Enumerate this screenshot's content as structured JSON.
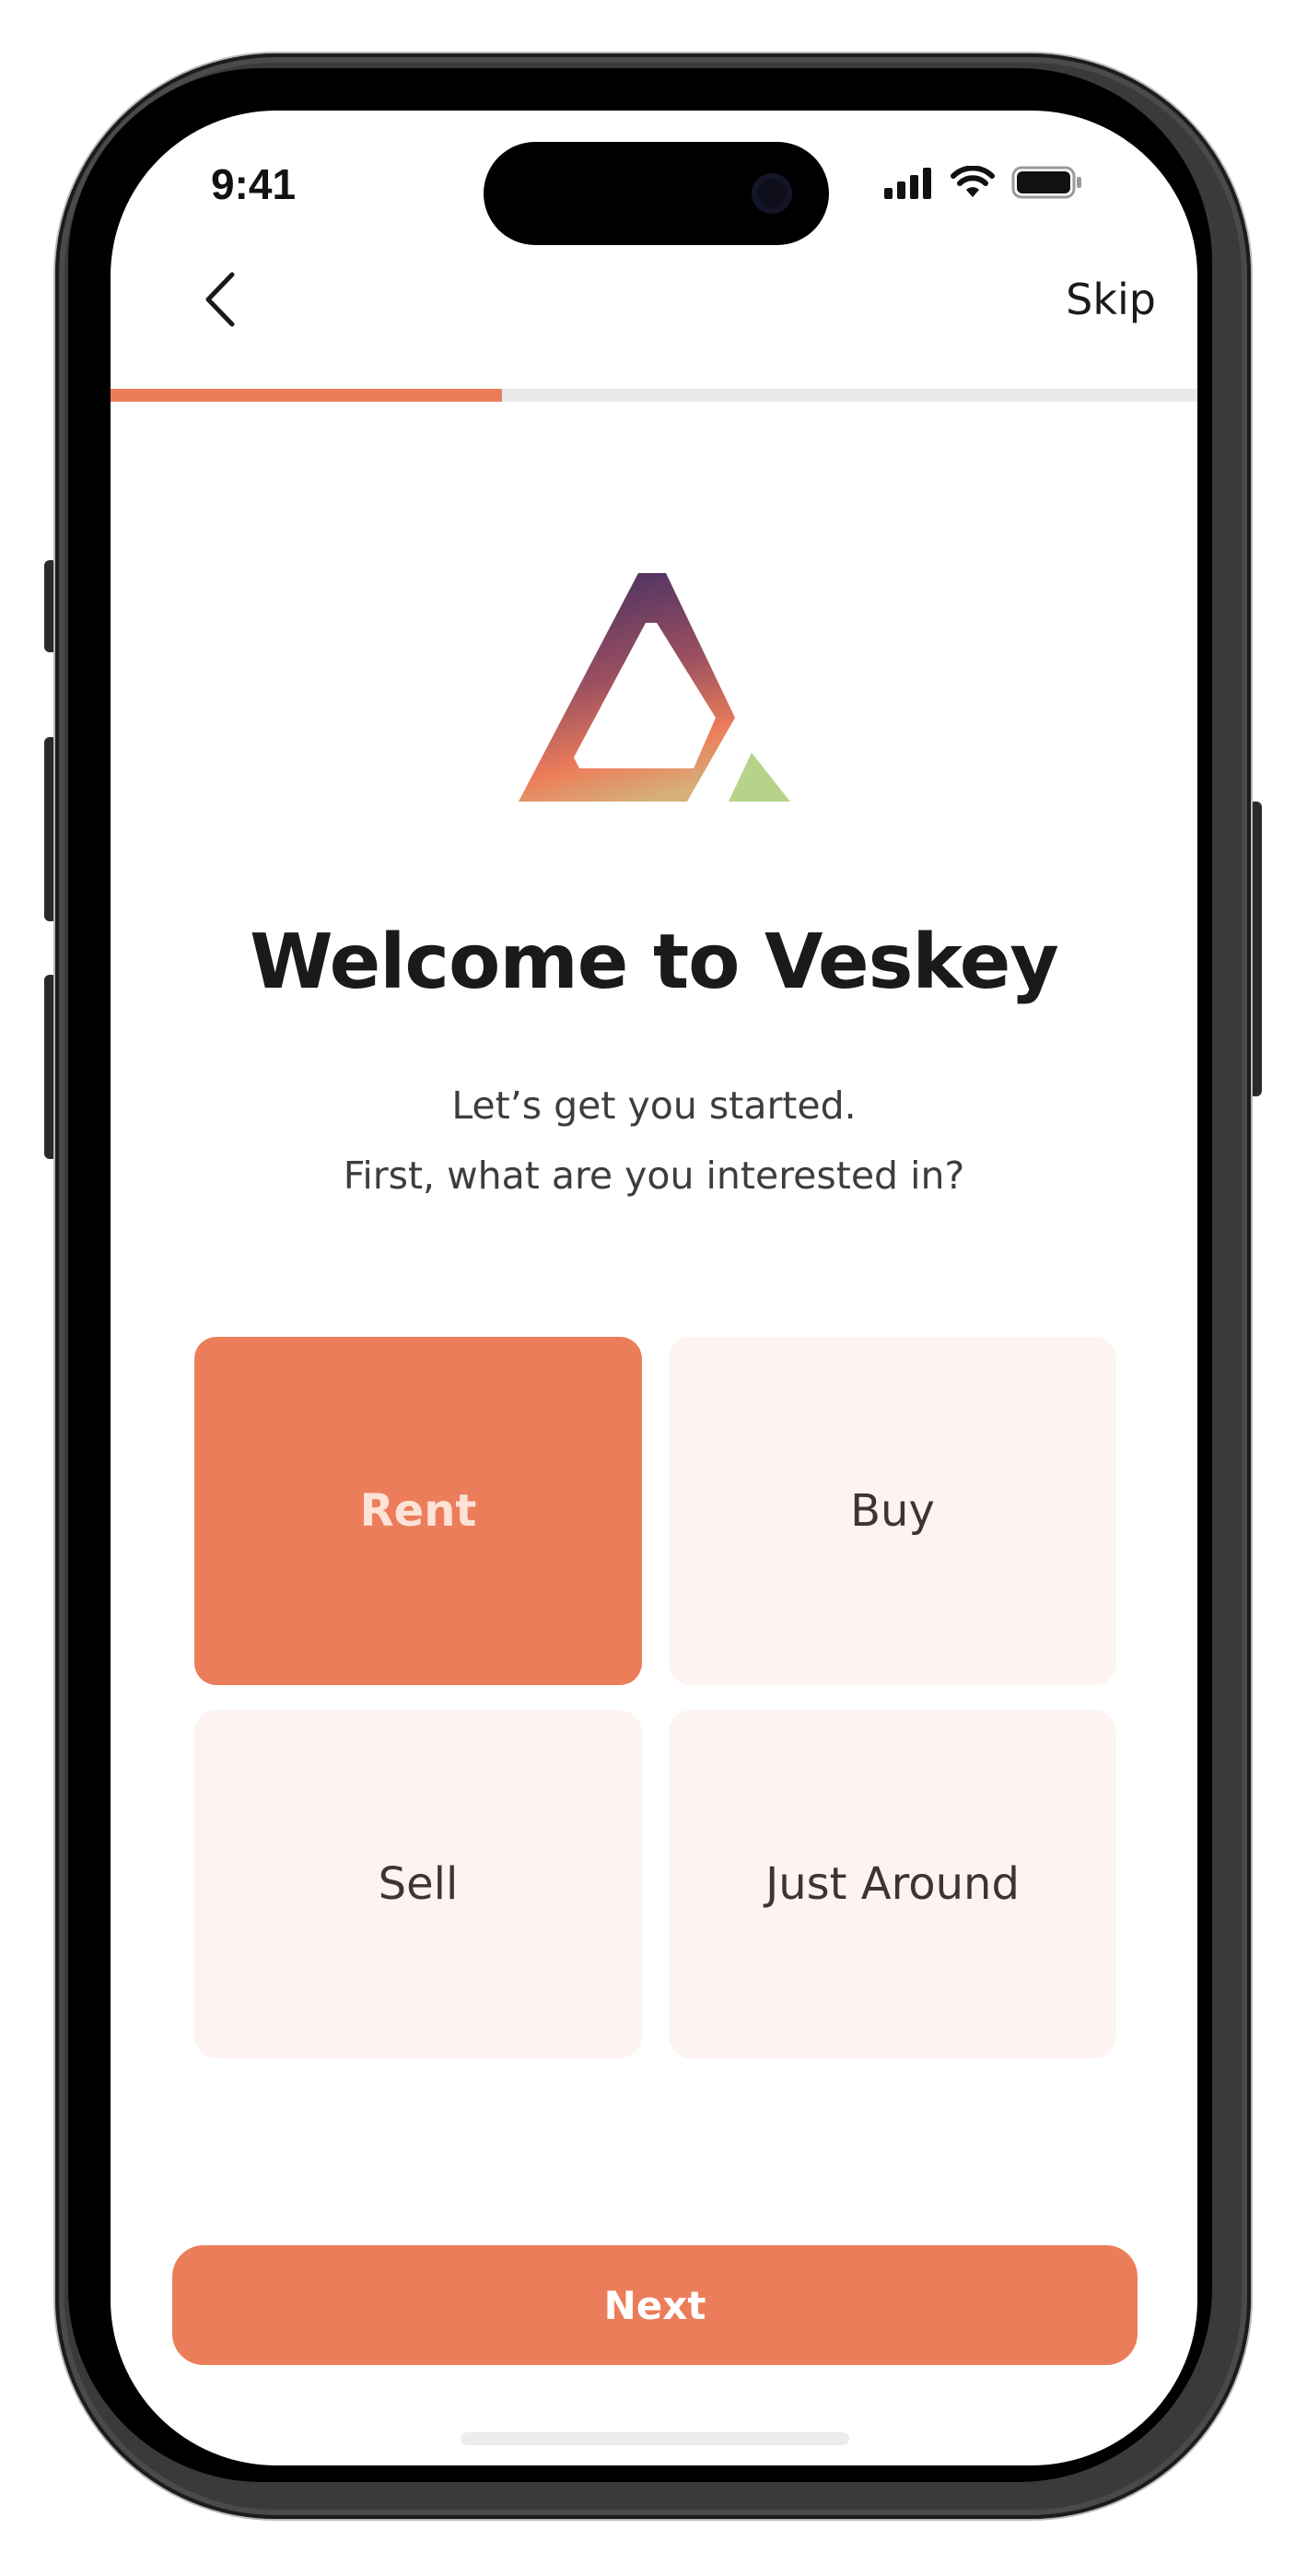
{
  "status_bar": {
    "time": "9:41",
    "icons": [
      "cellular-signal-icon",
      "wifi-icon",
      "battery-icon"
    ]
  },
  "top_bar": {
    "back_icon": "chevron-left-icon",
    "skip_label": "Skip"
  },
  "progress": {
    "fraction": 0.36,
    "fill_color": "#ec7d5a",
    "track_color": "#e9e9e9"
  },
  "logo": {
    "icon": "veskey-triangle-logo-icon",
    "gradient": [
      "#4b3264",
      "#ec7d5a",
      "#c9d48a"
    ],
    "accent_color": "#b5d48a"
  },
  "welcome": {
    "title": "Welcome to Veskey",
    "subtitle_line1": "Let’s get you started.",
    "subtitle_line2": "First, what are you interested in?"
  },
  "options": [
    {
      "label": "Rent",
      "selected": true
    },
    {
      "label": "Buy",
      "selected": false
    },
    {
      "label": "Sell",
      "selected": false
    },
    {
      "label": "Just Around",
      "selected": false
    }
  ],
  "next_button": {
    "label": "Next"
  },
  "colors": {
    "accent": "#ec7d5a",
    "option_background": "#fdf3f1",
    "selected_text": "#fde2d8"
  }
}
